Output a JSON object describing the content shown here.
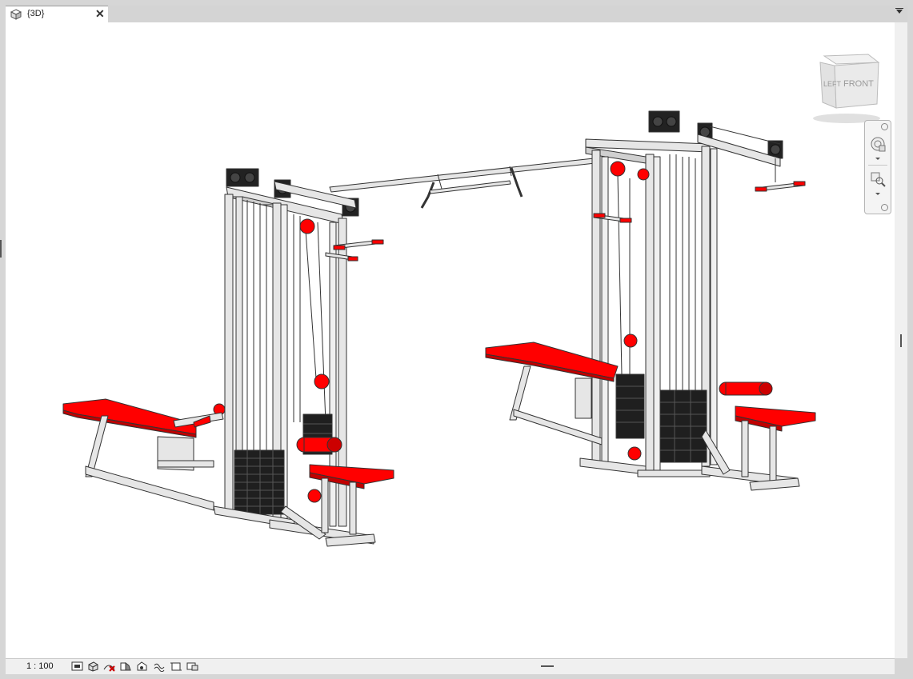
{
  "tab": {
    "label": "{3D}",
    "close_label": "✕",
    "icon": "3d-view-icon"
  },
  "viewcube": {
    "left_label": "LEFT",
    "front_label": "FRONT"
  },
  "navbar": {
    "icons": [
      "full-navigation-wheel-icon",
      "zoom-region-icon"
    ]
  },
  "statusbar": {
    "scale": "1 : 100",
    "icons": [
      "detail-level-icon",
      "visual-style-icon",
      "sun-path-off-icon",
      "shadows-off-icon",
      "show-rendering-icon",
      "crop-view-icon",
      "hide-crop-region-icon",
      "temporary-hide-isolate-icon"
    ]
  },
  "model": {
    "frame_color": "#e6e6e6",
    "pad_color": "#ff0000",
    "weight_stack_color": "#1f1f1f"
  }
}
